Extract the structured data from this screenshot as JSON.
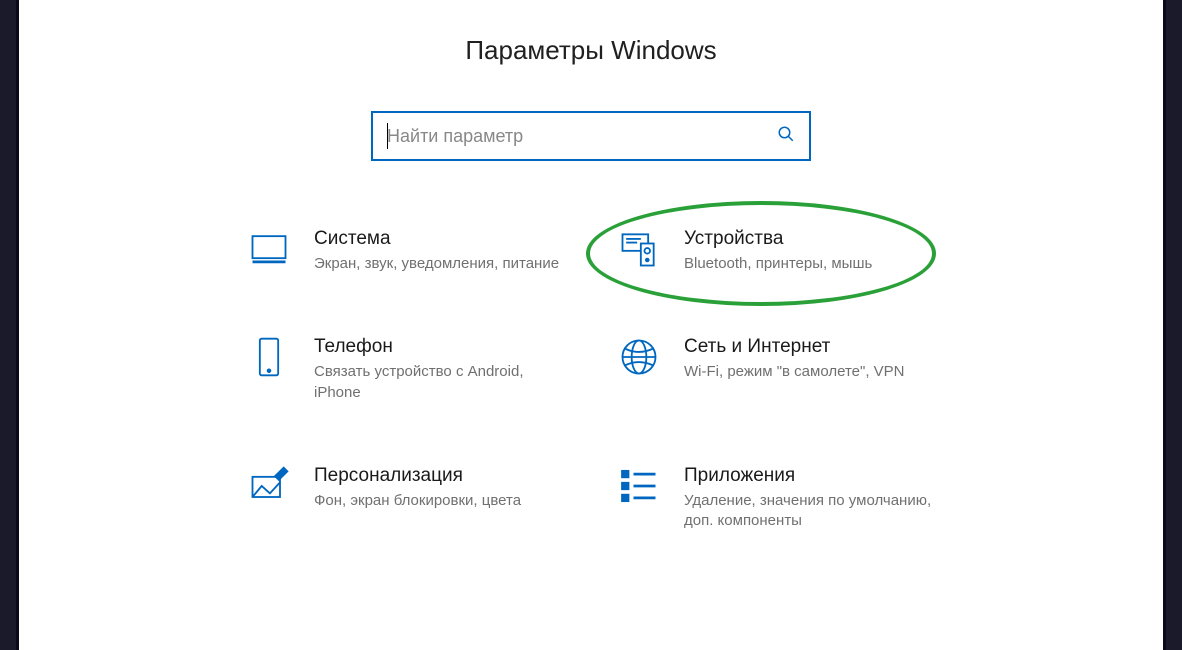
{
  "title": "Параметры Windows",
  "search": {
    "placeholder": "Найти параметр"
  },
  "items": [
    {
      "title": "Система",
      "desc": "Экран, звук, уведомления, питание",
      "icon": "system"
    },
    {
      "title": "Устройства",
      "desc": "Bluetooth, принтеры, мышь",
      "icon": "devices",
      "highlight": true
    },
    {
      "title": "Телефон",
      "desc": "Связать устройство с Android, iPhone",
      "icon": "phone"
    },
    {
      "title": "Сеть и Интернет",
      "desc": "Wi-Fi, режим \"в самолете\", VPN",
      "icon": "network"
    },
    {
      "title": "Персонализация",
      "desc": "Фон, экран блокировки, цвета",
      "icon": "personalization"
    },
    {
      "title": "Приложения",
      "desc": "Удаление, значения по умолчанию, доп. компоненты",
      "icon": "apps"
    }
  ]
}
